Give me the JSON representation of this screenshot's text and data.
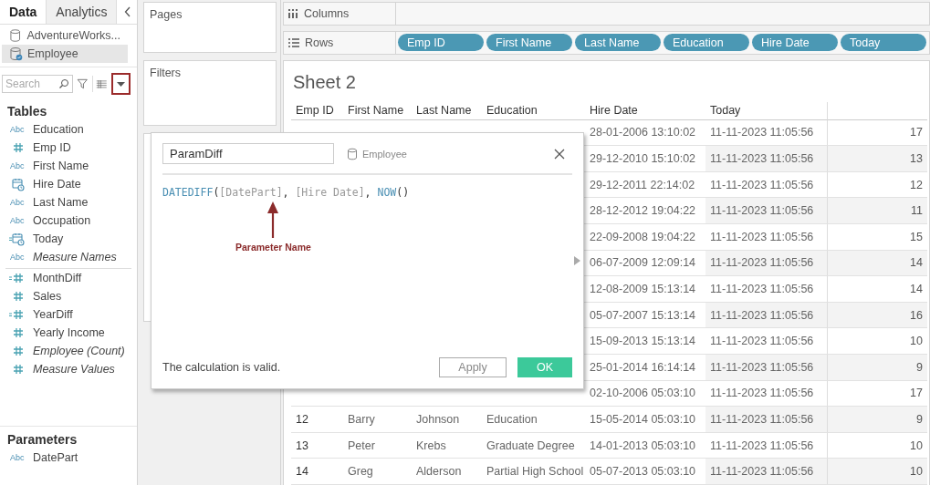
{
  "left_pane": {
    "tabs": [
      {
        "label": "Data",
        "selected": true
      },
      {
        "label": "Analytics",
        "selected": false
      }
    ],
    "data_sources": [
      {
        "name": "AdventureWorks...",
        "selected": false,
        "kind": "database"
      },
      {
        "name": "Employee",
        "selected": true,
        "kind": "database-live"
      }
    ],
    "search": {
      "placeholder": "Search"
    },
    "tables_heading": "Tables",
    "fields": [
      {
        "name": "Education",
        "kind": "string",
        "type_label": "Abc",
        "calculated": false,
        "generated": false
      },
      {
        "name": "Emp ID",
        "kind": "number",
        "calculated": false,
        "generated": false
      },
      {
        "name": "First Name",
        "kind": "string",
        "type_label": "Abc",
        "calculated": false,
        "generated": false
      },
      {
        "name": "Hire Date",
        "kind": "date",
        "calculated": false,
        "generated": false
      },
      {
        "name": "Last Name",
        "kind": "string",
        "type_label": "Abc",
        "calculated": false,
        "generated": false
      },
      {
        "name": "Occupation",
        "kind": "string",
        "type_label": "Abc",
        "calculated": false,
        "generated": false
      },
      {
        "name": "Today",
        "kind": "date",
        "calculated": true,
        "generated": false
      },
      {
        "name": "Measure Names",
        "kind": "string",
        "type_label": "Abc",
        "calculated": false,
        "generated": true
      }
    ],
    "measures": [
      {
        "name": "MonthDiff",
        "kind": "number",
        "calculated": true,
        "generated": false
      },
      {
        "name": "Sales",
        "kind": "number",
        "calculated": false,
        "generated": false
      },
      {
        "name": "YearDiff",
        "kind": "number",
        "calculated": true,
        "generated": false
      },
      {
        "name": "Yearly Income",
        "kind": "number",
        "calculated": false,
        "generated": false
      },
      {
        "name": "Employee (Count)",
        "kind": "number",
        "calculated": false,
        "generated": true
      },
      {
        "name": "Measure Values",
        "kind": "number",
        "calculated": false,
        "generated": true
      }
    ],
    "parameters_heading": "Parameters",
    "parameters": [
      {
        "name": "DatePart",
        "kind": "string",
        "type_label": "Abc",
        "calculated": false,
        "generated": false
      }
    ]
  },
  "cards": [
    {
      "title": "Pages"
    },
    {
      "title": "Filters"
    }
  ],
  "shelves": [
    {
      "kind": "columns",
      "label": "Columns"
    },
    {
      "kind": "rows",
      "label": "Rows",
      "pills": [
        "Emp ID",
        "First Name",
        "Last Name",
        "Education",
        "Hire Date",
        "Today"
      ]
    }
  ],
  "sheet": {
    "title": "Sheet 2",
    "columns": [
      "Emp ID",
      "First Name",
      "Last Name",
      "Education",
      "Hire Date",
      "Today"
    ],
    "rows": [
      {
        "hire_date": "28-01-2006 13:10:02",
        "today": "11-11-2023 11:05:56",
        "value": "17"
      },
      {
        "hire_date": "29-12-2010 15:10:02",
        "today": "11-11-2023 11:05:56",
        "value": "13"
      },
      {
        "hire_date": "29-12-2011 22:14:02",
        "today": "11-11-2023 11:05:56",
        "value": "12"
      },
      {
        "hire_date": "28-12-2012 19:04:22",
        "today": "11-11-2023 11:05:56",
        "value": "11"
      },
      {
        "hire_date": "22-09-2008 19:04:22",
        "today": "11-11-2023 11:05:56",
        "value": "15"
      },
      {
        "hire_date": "06-07-2009 12:09:14",
        "today": "11-11-2023 11:05:56",
        "value": "14"
      },
      {
        "hire_date": "12-08-2009 15:13:14",
        "today": "11-11-2023 11:05:56",
        "value": "14"
      },
      {
        "hire_date": "05-07-2007 15:13:14",
        "today": "11-11-2023 11:05:56",
        "value": "16"
      },
      {
        "hire_date": "15-09-2013 15:13:14",
        "today": "11-11-2023 11:05:56",
        "value": "10"
      },
      {
        "hire_date": "25-01-2014 16:14:14",
        "today": "11-11-2023 11:05:56",
        "value": "9"
      },
      {
        "hire_date": "02-10-2006 05:03:10",
        "today": "11-11-2023 11:05:56",
        "value": "17"
      },
      {
        "emp_id": "12",
        "first_name": "Barry",
        "last_name": "Johnson",
        "education": "Education",
        "hire_date": "15-05-2014 05:03:10",
        "today": "11-11-2023 11:05:56",
        "value": "9"
      },
      {
        "emp_id": "13",
        "first_name": "Peter",
        "last_name": "Krebs",
        "education": "Graduate Degree",
        "hire_date": "14-01-2013 05:03:10",
        "today": "11-11-2023 11:05:56",
        "value": "10"
      },
      {
        "emp_id": "14",
        "first_name": "Greg",
        "last_name": "Alderson",
        "education": "Partial High School",
        "hire_date": "05-07-2013 05:03:10",
        "today": "11-11-2023 11:05:56",
        "value": "10"
      }
    ]
  },
  "dialog": {
    "name": "ParamDiff",
    "data_source": "Employee",
    "formula": [
      {
        "text": "DATEDIFF",
        "kind": "function"
      },
      {
        "text": "(",
        "kind": "punct"
      },
      {
        "text": "[DatePart]",
        "kind": "field"
      },
      {
        "text": ", ",
        "kind": "punct"
      },
      {
        "text": "[Hire Date]",
        "kind": "field"
      },
      {
        "text": ", ",
        "kind": "punct"
      },
      {
        "text": "NOW",
        "kind": "function"
      },
      {
        "text": "()",
        "kind": "punct"
      }
    ],
    "annotation": "Parameter Name",
    "status": "The calculation is valid.",
    "buttons": [
      {
        "label": "Apply",
        "kind": "secondary"
      },
      {
        "label": "OK",
        "kind": "primary"
      }
    ]
  }
}
